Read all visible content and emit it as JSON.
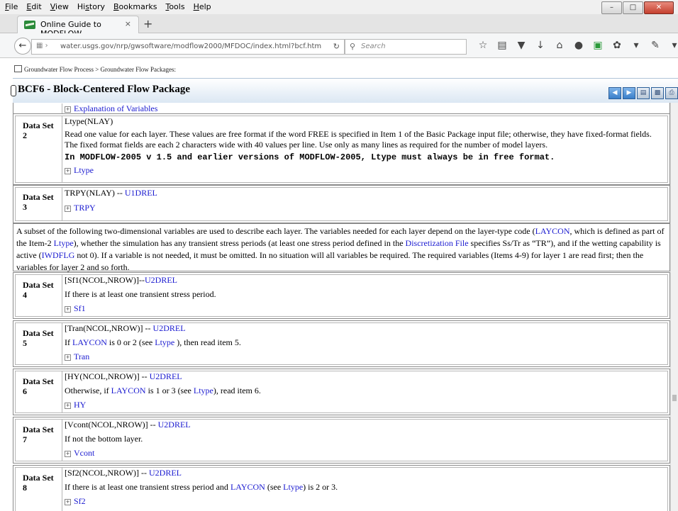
{
  "menubar": {
    "items": [
      "File",
      "Edit",
      "View",
      "History",
      "Bookmarks",
      "Tools",
      "Help"
    ],
    "underline": [
      "F",
      "E",
      "V",
      "s",
      "B",
      "T",
      "H"
    ]
  },
  "tab": {
    "title": "Online Guide to MODFLOW",
    "close": "×",
    "new": "+"
  },
  "nav": {
    "url": "water.usgs.gov/nrp/gwsoftware/modflow2000/MFDOC/index.html?bcf.htm",
    "search_placeholder": "Search"
  },
  "breadcrumb": "Groundwater Flow Process > Groundwater Flow Packages:",
  "page_title": "BCF6 - Block-Centered Flow Package",
  "top_link": "Explanation of Variables",
  "ds2": {
    "label": "Data Set 2",
    "header": "Ltype(NLAY)",
    "text": "Read one value for each layer. These values are free format if the word FREE is specified in Item 1 of the Basic Package input file; otherwise, they have fixed-format fields. The fixed format fields are each 2 characters wide with 40 values per line. Use only as many lines as required for the number of model layers.",
    "note": "In MODFLOW-2005 v 1.5 and earlier versions of MODFLOW-2005, Ltype must always be in free format.",
    "expander": "Ltype"
  },
  "ds3": {
    "label": "Data Set 3",
    "header_pre": "TRPY(NLAY) -- ",
    "header_link": "U1DREL",
    "expander": "TRPY"
  },
  "subset": {
    "t1": "A subset of the following two-dimensional variables are used to describe each layer. The variables needed for each layer depend on the layer-type code (",
    "l1": "LAYCON",
    "t2": ", which is defined as part of the Item-2 ",
    "l2": "Ltype",
    "t3": "), whether the simulation has any transient stress periods (at least one stress period defined in the ",
    "l3": "Discretization File",
    "t4": " specifies Ss/Tr as “TR”), and if the wetting capability is active (",
    "l4": "IWDFLG",
    "t5": " not 0). If a variable is not needed, it must be omitted. In no situation will all variables be required. The required variables (Items 4-9) for layer 1 are read first; then the variables for layer 2 and so forth."
  },
  "ds4": {
    "label": "Data Set 4",
    "header_pre": "[Sf1(NCOL,NROW)]--",
    "header_link": "U2DREL",
    "text": "If there is at least one transient stress period.",
    "expander": "Sf1"
  },
  "ds5": {
    "label": "Data Set 5",
    "header_pre": "[Tran(NCOL,NROW)] -- ",
    "header_link": "U2DREL",
    "t1": "If ",
    "l1": "LAYCON",
    "t2": " is 0 or 2 (see ",
    "l2": "Ltype",
    "t3": " ), then read item 5.",
    "expander": "Tran"
  },
  "ds6": {
    "label": "Data Set 6",
    "header_pre": "[HY(NCOL,NROW)] -- ",
    "header_link": "U2DREL",
    "t1": "Otherwise, if ",
    "l1": "LAYCON",
    "t2": " is 1 or 3 (see ",
    "l2": "Ltype",
    "t3": "), read item 6.",
    "expander": "HY"
  },
  "ds7": {
    "label": "Data Set 7",
    "header_pre": "[Vcont(NCOL,NROW)] -- ",
    "header_link": "U2DREL",
    "text": "If not the bottom layer.",
    "expander": "Vcont"
  },
  "ds8": {
    "label": "Data Set 8",
    "header_pre": "[Sf2(NCOL,NROW)] -- ",
    "header_link": "U2DREL",
    "t1": "If there is at least one transient stress period and ",
    "l1": "LAYCON",
    "t2": " (see ",
    "l2": "Ltype",
    "t3": ") is 2 or 3.",
    "expander": "Sf2"
  }
}
